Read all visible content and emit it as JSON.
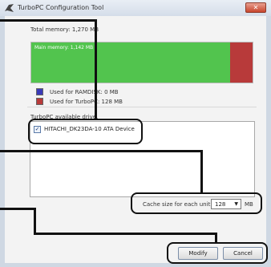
{
  "window": {
    "title": "TurboPC Configuration Tool"
  },
  "memory": {
    "total_label": "Total memory: 1,270 MB",
    "main_label": "Main memory: 1,142 MB",
    "main_fraction": 0.899,
    "turbopc_fraction": 0.101,
    "ramdisk_label": "Used for RAMDISK: 0 MB",
    "turbopc_label": "Used for TurboPC: 128 MB"
  },
  "colors": {
    "main": "#52c44e",
    "turbopc": "#b83a3a",
    "ramdisk": "#3a3ab8"
  },
  "drives": {
    "section_label": "TurboPC available drive.",
    "items": [
      {
        "label": "HITACHI_DK23DA-10 ATA Device",
        "checked": true
      }
    ]
  },
  "cache": {
    "label": "Cache size for each unit.",
    "value": "128",
    "unit": "MB"
  },
  "buttons": {
    "modify": "Modify",
    "cancel": "Cancel"
  },
  "icons": {
    "app": "turbopc-icon",
    "close": "close-icon",
    "dropdown": "chevron-down-icon",
    "check": "checkmark-icon"
  }
}
